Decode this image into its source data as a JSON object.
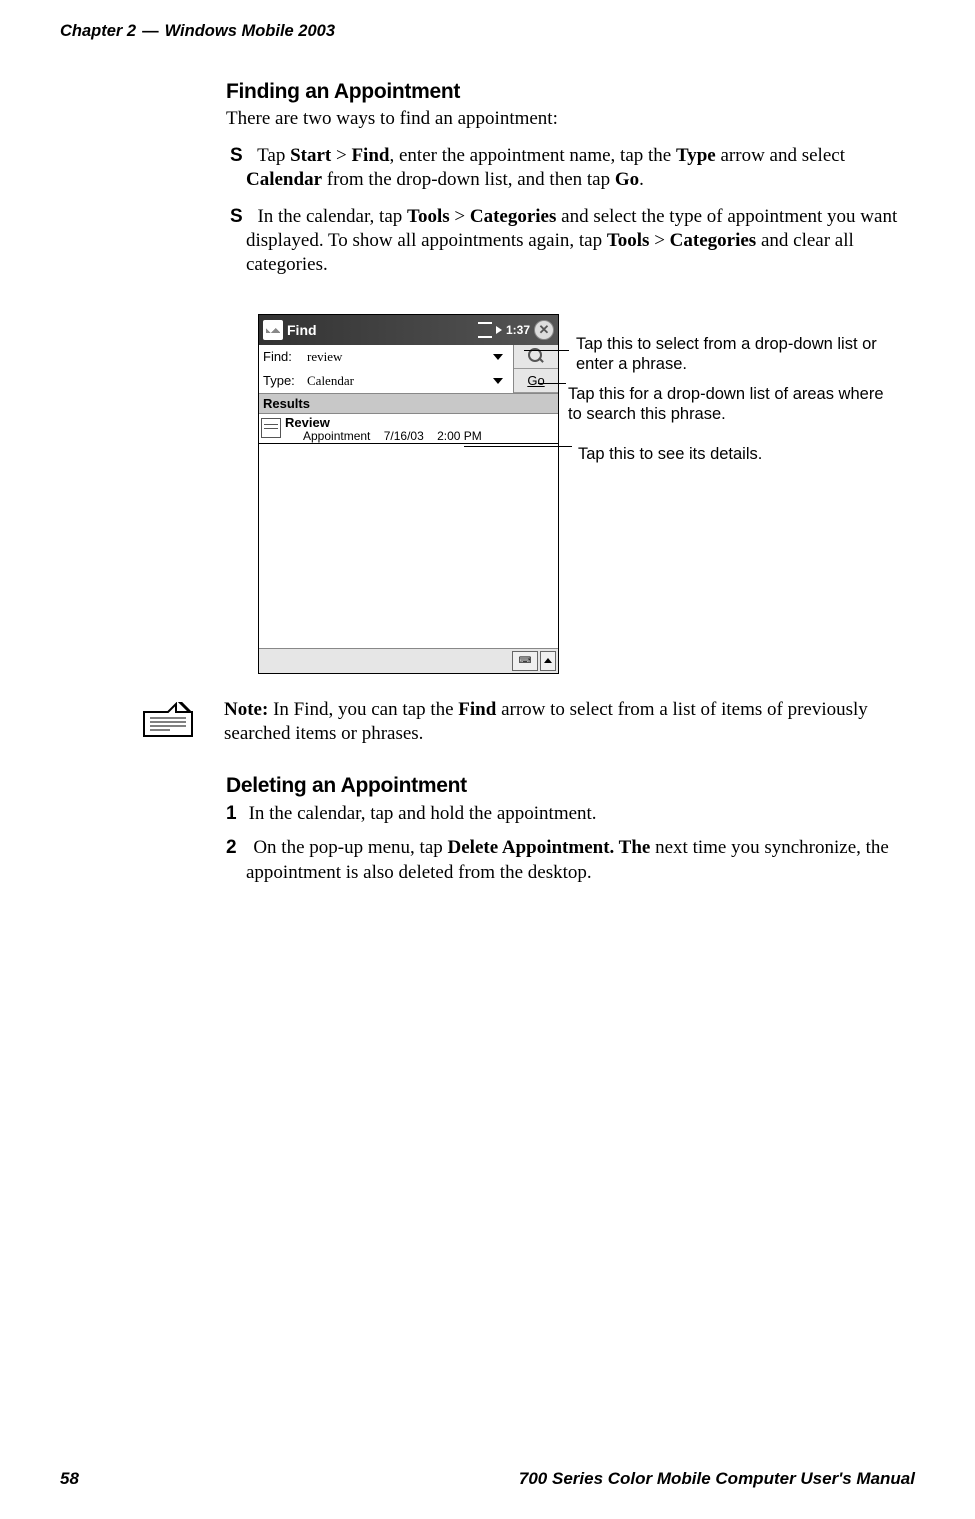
{
  "header": {
    "chapter": "Chapter 2",
    "dash": "—",
    "title": "Windows Mobile 2003"
  },
  "section_finding": {
    "heading": "Finding an Appointment",
    "intro": "There are two ways to find an appointment:",
    "bullet1": {
      "pre": "Tap ",
      "b1": "Start",
      "gt1": " > ",
      "b2": "Find",
      "mid1": ", enter the appointment name, tap the ",
      "b3": "Type",
      "mid2": " arrow and select ",
      "b4": "Calendar",
      "mid3": " from the drop-down list, and then tap ",
      "b5": "Go",
      "end": "."
    },
    "bullet2": {
      "pre": "In the calendar, tap ",
      "b1": "Tools",
      "gt1": " > ",
      "b2": "Categories",
      "mid1": " and select the type of appointment you want displayed. To show all appointments again, tap ",
      "b3": "Tools",
      "gt2": " > ",
      "b4": "Categories",
      "end": " and clear all categories."
    }
  },
  "device": {
    "title": "Find",
    "time": "1:37",
    "find_label": "Find:",
    "find_value": "review",
    "type_label": "Type:",
    "type_value": "Calendar",
    "go_label": "Go",
    "results_label": "Results",
    "result_title": "Review",
    "result_sub": "Appointment    7/16/03    2:00 PM"
  },
  "callouts": {
    "c1": "Tap this to select from a drop-down list or enter a phrase.",
    "c2": "Tap this for a drop-down list of areas where to search this phrase.",
    "c3": "Tap this to see its details."
  },
  "note": {
    "label": "Note:",
    "text": " In Find, you can tap the ",
    "b1": "Find",
    "text2": " arrow to select from a list of items of previously searched items or phrases."
  },
  "section_deleting": {
    "heading": "Deleting an Appointment",
    "step1": "In the calendar, tap and hold the appointment.",
    "step2": {
      "pre": "On the pop-up menu, tap ",
      "b1": "Delete Appointment. The",
      "post": " next time you synchronize, the appointment is also deleted from the desktop."
    }
  },
  "footer": {
    "page": "58",
    "manual": "700 Series Color Mobile Computer User's Manual"
  }
}
